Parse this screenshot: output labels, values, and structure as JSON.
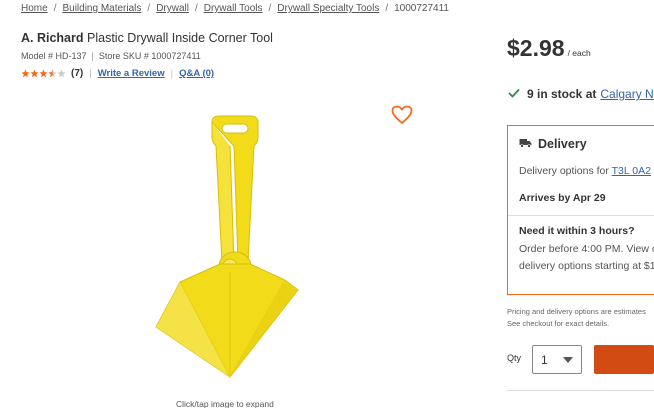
{
  "breadcrumb": {
    "items": [
      "Home",
      "Building Materials",
      "Drywall",
      "Drywall Tools",
      "Drywall Specialty Tools"
    ],
    "current": "1000727411",
    "separator": "/"
  },
  "product": {
    "brand": "A. Richard",
    "name": "Plastic Drywall Inside Corner Tool",
    "model_label": "Model # HD-137",
    "sku_label": "Store SKU # 1000727411",
    "rating": 3.5,
    "rating_max": 5,
    "review_count": "(7)",
    "write_review": "Write a Review",
    "qa": "Q&A (0)",
    "image_caption": "Click/tap image to expand",
    "image_color": "#f2dc1a"
  },
  "price": {
    "amount": "$2.98",
    "unit": "/ each"
  },
  "stock": {
    "text": "9 in stock at",
    "store_link": "Calgary No",
    "icon": "check-icon"
  },
  "delivery": {
    "heading": "Delivery",
    "options_text": "Delivery options for",
    "postal_link": "T3L 0A2",
    "arrives": "Arrives by Apr 29",
    "need_it": "Need it within 3 hours?",
    "order_line1": "Order before 4:00 PM. View c",
    "order_line2": "delivery options starting at $1",
    "icon": "truck-icon",
    "border_color": "#f26a1b"
  },
  "fineprint": {
    "line1": "Pricing and delivery options are estimates",
    "line2": "See checkout for exact details."
  },
  "quantity": {
    "label": "Qty",
    "value": "1"
  },
  "colors": {
    "accent": "#d34b14",
    "link": "#3366a8",
    "star": "#f26a1b",
    "check": "#2e8540"
  }
}
